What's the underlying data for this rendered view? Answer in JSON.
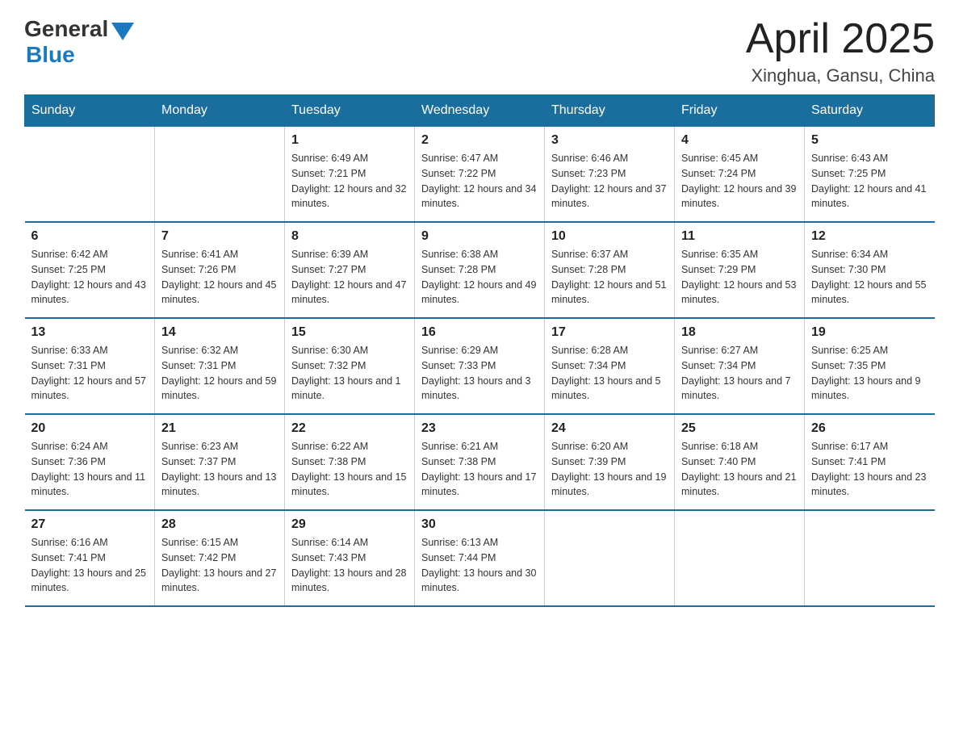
{
  "header": {
    "logo_general": "General",
    "logo_blue": "Blue",
    "title": "April 2025",
    "subtitle": "Xinghua, Gansu, China"
  },
  "days_of_week": [
    "Sunday",
    "Monday",
    "Tuesday",
    "Wednesday",
    "Thursday",
    "Friday",
    "Saturday"
  ],
  "weeks": [
    [
      {
        "day": "",
        "sunrise": "",
        "sunset": "",
        "daylight": ""
      },
      {
        "day": "",
        "sunrise": "",
        "sunset": "",
        "daylight": ""
      },
      {
        "day": "1",
        "sunrise": "Sunrise: 6:49 AM",
        "sunset": "Sunset: 7:21 PM",
        "daylight": "Daylight: 12 hours and 32 minutes."
      },
      {
        "day": "2",
        "sunrise": "Sunrise: 6:47 AM",
        "sunset": "Sunset: 7:22 PM",
        "daylight": "Daylight: 12 hours and 34 minutes."
      },
      {
        "day": "3",
        "sunrise": "Sunrise: 6:46 AM",
        "sunset": "Sunset: 7:23 PM",
        "daylight": "Daylight: 12 hours and 37 minutes."
      },
      {
        "day": "4",
        "sunrise": "Sunrise: 6:45 AM",
        "sunset": "Sunset: 7:24 PM",
        "daylight": "Daylight: 12 hours and 39 minutes."
      },
      {
        "day": "5",
        "sunrise": "Sunrise: 6:43 AM",
        "sunset": "Sunset: 7:25 PM",
        "daylight": "Daylight: 12 hours and 41 minutes."
      }
    ],
    [
      {
        "day": "6",
        "sunrise": "Sunrise: 6:42 AM",
        "sunset": "Sunset: 7:25 PM",
        "daylight": "Daylight: 12 hours and 43 minutes."
      },
      {
        "day": "7",
        "sunrise": "Sunrise: 6:41 AM",
        "sunset": "Sunset: 7:26 PM",
        "daylight": "Daylight: 12 hours and 45 minutes."
      },
      {
        "day": "8",
        "sunrise": "Sunrise: 6:39 AM",
        "sunset": "Sunset: 7:27 PM",
        "daylight": "Daylight: 12 hours and 47 minutes."
      },
      {
        "day": "9",
        "sunrise": "Sunrise: 6:38 AM",
        "sunset": "Sunset: 7:28 PM",
        "daylight": "Daylight: 12 hours and 49 minutes."
      },
      {
        "day": "10",
        "sunrise": "Sunrise: 6:37 AM",
        "sunset": "Sunset: 7:28 PM",
        "daylight": "Daylight: 12 hours and 51 minutes."
      },
      {
        "day": "11",
        "sunrise": "Sunrise: 6:35 AM",
        "sunset": "Sunset: 7:29 PM",
        "daylight": "Daylight: 12 hours and 53 minutes."
      },
      {
        "day": "12",
        "sunrise": "Sunrise: 6:34 AM",
        "sunset": "Sunset: 7:30 PM",
        "daylight": "Daylight: 12 hours and 55 minutes."
      }
    ],
    [
      {
        "day": "13",
        "sunrise": "Sunrise: 6:33 AM",
        "sunset": "Sunset: 7:31 PM",
        "daylight": "Daylight: 12 hours and 57 minutes."
      },
      {
        "day": "14",
        "sunrise": "Sunrise: 6:32 AM",
        "sunset": "Sunset: 7:31 PM",
        "daylight": "Daylight: 12 hours and 59 minutes."
      },
      {
        "day": "15",
        "sunrise": "Sunrise: 6:30 AM",
        "sunset": "Sunset: 7:32 PM",
        "daylight": "Daylight: 13 hours and 1 minute."
      },
      {
        "day": "16",
        "sunrise": "Sunrise: 6:29 AM",
        "sunset": "Sunset: 7:33 PM",
        "daylight": "Daylight: 13 hours and 3 minutes."
      },
      {
        "day": "17",
        "sunrise": "Sunrise: 6:28 AM",
        "sunset": "Sunset: 7:34 PM",
        "daylight": "Daylight: 13 hours and 5 minutes."
      },
      {
        "day": "18",
        "sunrise": "Sunrise: 6:27 AM",
        "sunset": "Sunset: 7:34 PM",
        "daylight": "Daylight: 13 hours and 7 minutes."
      },
      {
        "day": "19",
        "sunrise": "Sunrise: 6:25 AM",
        "sunset": "Sunset: 7:35 PM",
        "daylight": "Daylight: 13 hours and 9 minutes."
      }
    ],
    [
      {
        "day": "20",
        "sunrise": "Sunrise: 6:24 AM",
        "sunset": "Sunset: 7:36 PM",
        "daylight": "Daylight: 13 hours and 11 minutes."
      },
      {
        "day": "21",
        "sunrise": "Sunrise: 6:23 AM",
        "sunset": "Sunset: 7:37 PM",
        "daylight": "Daylight: 13 hours and 13 minutes."
      },
      {
        "day": "22",
        "sunrise": "Sunrise: 6:22 AM",
        "sunset": "Sunset: 7:38 PM",
        "daylight": "Daylight: 13 hours and 15 minutes."
      },
      {
        "day": "23",
        "sunrise": "Sunrise: 6:21 AM",
        "sunset": "Sunset: 7:38 PM",
        "daylight": "Daylight: 13 hours and 17 minutes."
      },
      {
        "day": "24",
        "sunrise": "Sunrise: 6:20 AM",
        "sunset": "Sunset: 7:39 PM",
        "daylight": "Daylight: 13 hours and 19 minutes."
      },
      {
        "day": "25",
        "sunrise": "Sunrise: 6:18 AM",
        "sunset": "Sunset: 7:40 PM",
        "daylight": "Daylight: 13 hours and 21 minutes."
      },
      {
        "day": "26",
        "sunrise": "Sunrise: 6:17 AM",
        "sunset": "Sunset: 7:41 PM",
        "daylight": "Daylight: 13 hours and 23 minutes."
      }
    ],
    [
      {
        "day": "27",
        "sunrise": "Sunrise: 6:16 AM",
        "sunset": "Sunset: 7:41 PM",
        "daylight": "Daylight: 13 hours and 25 minutes."
      },
      {
        "day": "28",
        "sunrise": "Sunrise: 6:15 AM",
        "sunset": "Sunset: 7:42 PM",
        "daylight": "Daylight: 13 hours and 27 minutes."
      },
      {
        "day": "29",
        "sunrise": "Sunrise: 6:14 AM",
        "sunset": "Sunset: 7:43 PM",
        "daylight": "Daylight: 13 hours and 28 minutes."
      },
      {
        "day": "30",
        "sunrise": "Sunrise: 6:13 AM",
        "sunset": "Sunset: 7:44 PM",
        "daylight": "Daylight: 13 hours and 30 minutes."
      },
      {
        "day": "",
        "sunrise": "",
        "sunset": "",
        "daylight": ""
      },
      {
        "day": "",
        "sunrise": "",
        "sunset": "",
        "daylight": ""
      },
      {
        "day": "",
        "sunrise": "",
        "sunset": "",
        "daylight": ""
      }
    ]
  ]
}
